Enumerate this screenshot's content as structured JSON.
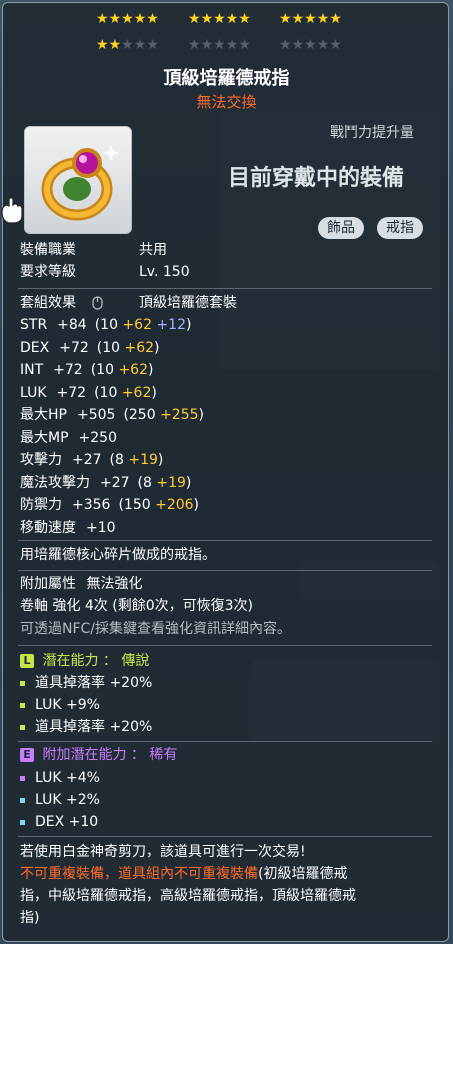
{
  "stars": {
    "groups": [
      {
        "filled": 5,
        "total": 5
      },
      {
        "filled": 5,
        "total": 5
      },
      {
        "filled": 5,
        "total": 5
      },
      {
        "filled": 2,
        "total": 5
      },
      {
        "filled": 0,
        "total": 5
      },
      {
        "filled": 0,
        "total": 5
      }
    ]
  },
  "item": {
    "name": "頂級培羅德戒指",
    "trade_status": "無法交換",
    "combat_power_label": "戰鬥力提升量",
    "equipped_label": "目前穿戴中的裝備",
    "tags": [
      "飾品",
      "戒指"
    ],
    "icon": "gold-ring-with-purple-gem"
  },
  "requirements": {
    "job_label": "裝備職業",
    "job_value": "共用",
    "level_label": "要求等級",
    "level_value": "Lv. 150"
  },
  "set": {
    "label": "套組效果",
    "icon": "mouse-icon",
    "value": "頂級培羅德套裝"
  },
  "stats": [
    {
      "name": "STR",
      "total": "+84",
      "base": "(10 ",
      "enh": "+62",
      "extra": " +12)"
    },
    {
      "name": "DEX",
      "total": "+72",
      "base": "(10 ",
      "enh": "+62",
      "extra": ")"
    },
    {
      "name": "INT",
      "total": "+72",
      "base": "(10 ",
      "enh": "+62",
      "extra": ")"
    },
    {
      "name": "LUK",
      "total": "+72",
      "base": "(10 ",
      "enh": "+62",
      "extra": ")"
    },
    {
      "name": "最大HP",
      "total": "+505",
      "base": "(250 ",
      "enh": "+255",
      "extra": ")"
    },
    {
      "name": "最大MP",
      "total": "+250",
      "base": "",
      "enh": "",
      "extra": ""
    },
    {
      "name": "攻擊力",
      "total": "+27",
      "base": "(8 ",
      "enh": "+19",
      "extra": ")"
    },
    {
      "name": "魔法攻擊力",
      "total": "+27",
      "base": "(8 ",
      "enh": "+19",
      "extra": ")"
    },
    {
      "name": "防禦力",
      "total": "+356",
      "base": "(150 ",
      "enh": "+206",
      "extra": ")"
    },
    {
      "name": "移動速度",
      "total": "+10",
      "base": "",
      "enh": "",
      "extra": ""
    }
  ],
  "description": "用培羅德核心碎片做成的戒指。",
  "attributes": {
    "extra_label": "附加屬性",
    "extra_value": "無法強化",
    "scroll_text": "卷軸 強化 4次 (剩餘0次，可恢復3次)",
    "npc_hint": "可透過NFC/採集鍵查看強化資訊詳細內容。"
  },
  "potential": {
    "badge": "L",
    "label": "潛在能力 ： 傳說",
    "lines": [
      "道具掉落率 +20%",
      "LUK +9%",
      "道具掉落率 +20%"
    ],
    "color": "#c8e64a"
  },
  "additional_potential": {
    "badge": "E",
    "label": "附加潛在能力 ： 稀有",
    "lines": [
      "LUK +4%",
      "LUK +2%",
      "DEX +10"
    ],
    "color": "#c77dff"
  },
  "footer": {
    "scissors": "若使用白金神奇剪刀，該道具可進行一次交易!",
    "unique_red": "不可重複裝備，道具組內不可重複裝備",
    "unique_white_1": "(初級培羅德戒",
    "unique_line2": "指，中級培羅德戒指，高級培羅德戒指，頂級培羅德戒",
    "unique_line3": "指)"
  }
}
